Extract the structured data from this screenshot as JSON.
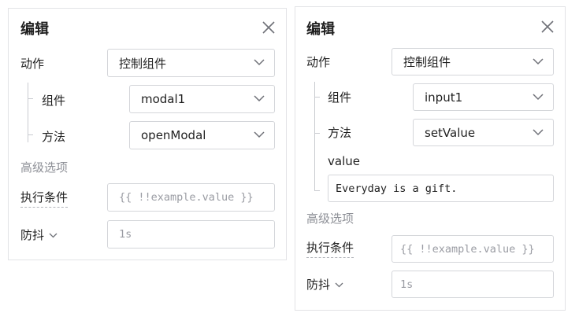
{
  "panel1": {
    "title": "编辑",
    "action_label": "动作",
    "action_value": "控制组件",
    "component_label": "组件",
    "component_value": "modal1",
    "method_label": "方法",
    "method_value": "openModal",
    "advanced_label": "高级选项",
    "condition_label": "执行条件",
    "condition_placeholder": "{{ !!example.value }}",
    "debounce_label": "防抖",
    "debounce_placeholder": "1s"
  },
  "panel2": {
    "title": "编辑",
    "action_label": "动作",
    "action_value": "控制组件",
    "component_label": "组件",
    "component_value": "input1",
    "method_label": "方法",
    "method_value": "setValue",
    "value_label": "value",
    "value_input": "Everyday is a gift.",
    "advanced_label": "高级选项",
    "condition_label": "执行条件",
    "condition_placeholder": "{{ !!example.value }}",
    "debounce_label": "防抖",
    "debounce_placeholder": "1s"
  },
  "icons": {
    "close": "close-icon",
    "chevron": "chevron-down-icon"
  },
  "colors": {
    "border": "#d4d6da",
    "muted_text": "#8e9097",
    "tree_line": "#c9cbd0"
  }
}
